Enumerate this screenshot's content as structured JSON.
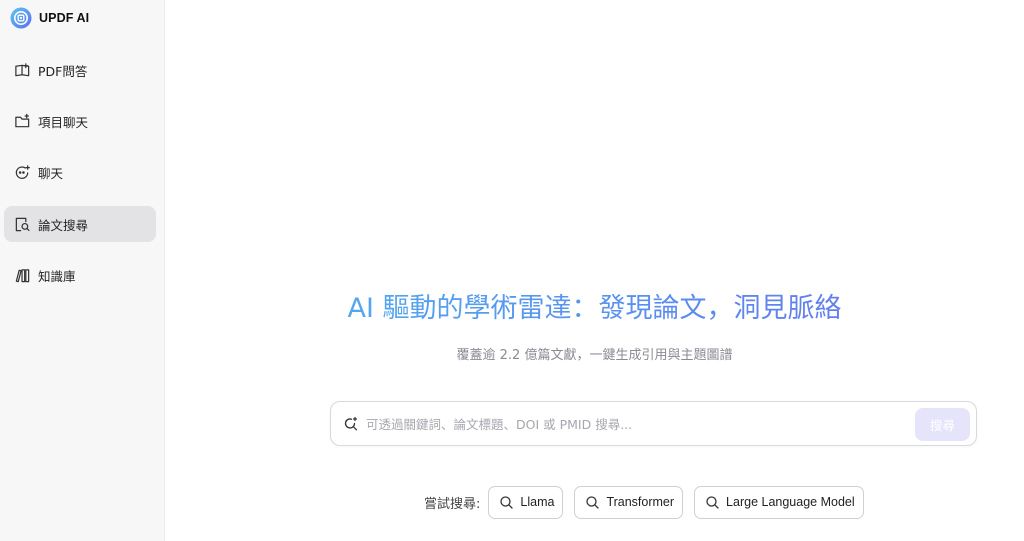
{
  "brand": {
    "name": "UPDF AI",
    "logo_icon": "updf-logo-icon",
    "accent": "#5b8def"
  },
  "sidebar": {
    "items": [
      {
        "label": "PDF問答",
        "icon": "book-open-icon",
        "active": false
      },
      {
        "label": "項目聊天",
        "icon": "folder-plus-icon",
        "active": false
      },
      {
        "label": "聊天",
        "icon": "chat-bubble-icon",
        "active": false
      },
      {
        "label": "論文搜尋",
        "icon": "document-search-icon",
        "active": true
      },
      {
        "label": "知識庫",
        "icon": "library-books-icon",
        "active": false
      }
    ]
  },
  "hero": {
    "title": "AI 驅動的學術雷達：發現論文，洞見脈絡",
    "subtitle": "覆蓋逾 2.2 億篇文獻，一鍵生成引用與主題圖譜",
    "gradient": [
      "#4fb6ec",
      "#6a6fe8"
    ]
  },
  "search": {
    "placeholder": "可透過關鍵詞、論文標題、DOI 或 PMID 搜尋...",
    "value": "",
    "button_label": "搜尋"
  },
  "suggestions": {
    "label": "嘗試搜尋:",
    "chips": [
      "Llama",
      "Transformer",
      "Large Language Model"
    ]
  }
}
